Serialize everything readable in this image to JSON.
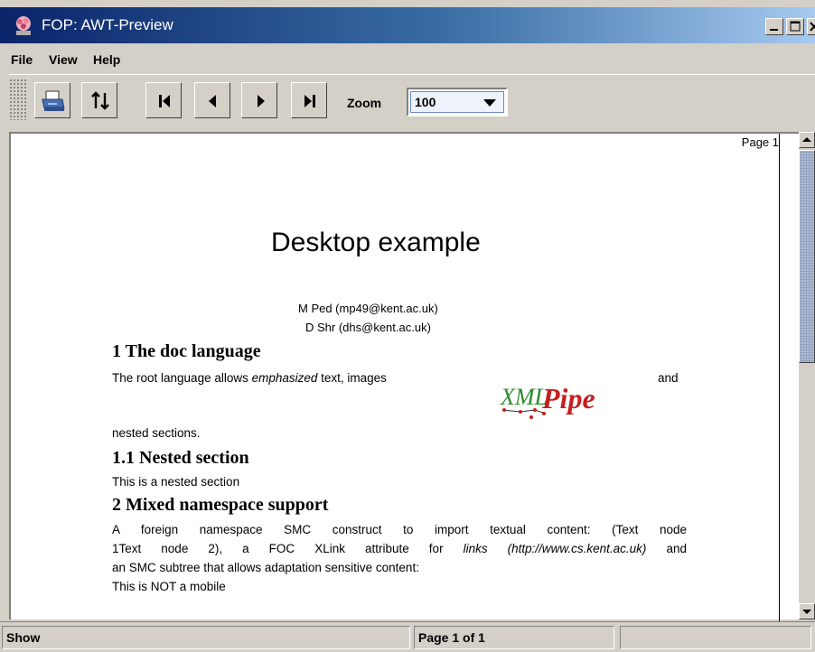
{
  "window": {
    "title": "FOP: AWT-Preview",
    "title_gradient_start": "#0a246a",
    "title_gradient_end": "#a6caf0",
    "controls": [
      "minimize-icon",
      "maximize-icon",
      "close-icon"
    ]
  },
  "menu": {
    "items": [
      {
        "label": "File"
      },
      {
        "label": "View"
      },
      {
        "label": "Help"
      }
    ]
  },
  "toolbar": {
    "buttons": [
      {
        "icon": "print-icon"
      },
      {
        "icon": "reload-icon"
      },
      {
        "icon": "first-page-icon"
      },
      {
        "icon": "previous-page-icon"
      },
      {
        "icon": "next-page-icon"
      },
      {
        "icon": "last-page-icon"
      }
    ],
    "zoom_label": "Zoom",
    "zoom_value": "100"
  },
  "document": {
    "page_label": "Page 1",
    "title": "Desktop example",
    "authors": [
      "M Ped (mp49@kent.ac.uk)",
      "D Shr (dhs@kent.ac.uk)"
    ],
    "sections": [
      {
        "heading": "1 The doc language",
        "intro_before_em": "The root language allows ",
        "emphasis": "emphasized",
        "intro_after_em": " text, images",
        "trailing_word": "and",
        "continuation": "nested sections.",
        "image_text_left": "XML",
        "image_text_right": "Pipe"
      },
      {
        "heading": "1.1 Nested section",
        "body": "This is a nested section"
      },
      {
        "heading": "2 Mixed namespace support",
        "line1": "A foreign namespace SMC construct to import textual content: (Text node",
        "line2_before_link": "1Text node 2), a FOC XLink attribute for ",
        "link_text": "links (http://www.cs.kent.ac.uk)",
        "line2_after_link": " and",
        "line3": "an SMC subtree that allows adaptation sensitive content:",
        "line4": "This is NOT a mobile"
      }
    ]
  },
  "status": {
    "left": "Show",
    "page_info": "Page 1 of 1",
    "right": ""
  }
}
